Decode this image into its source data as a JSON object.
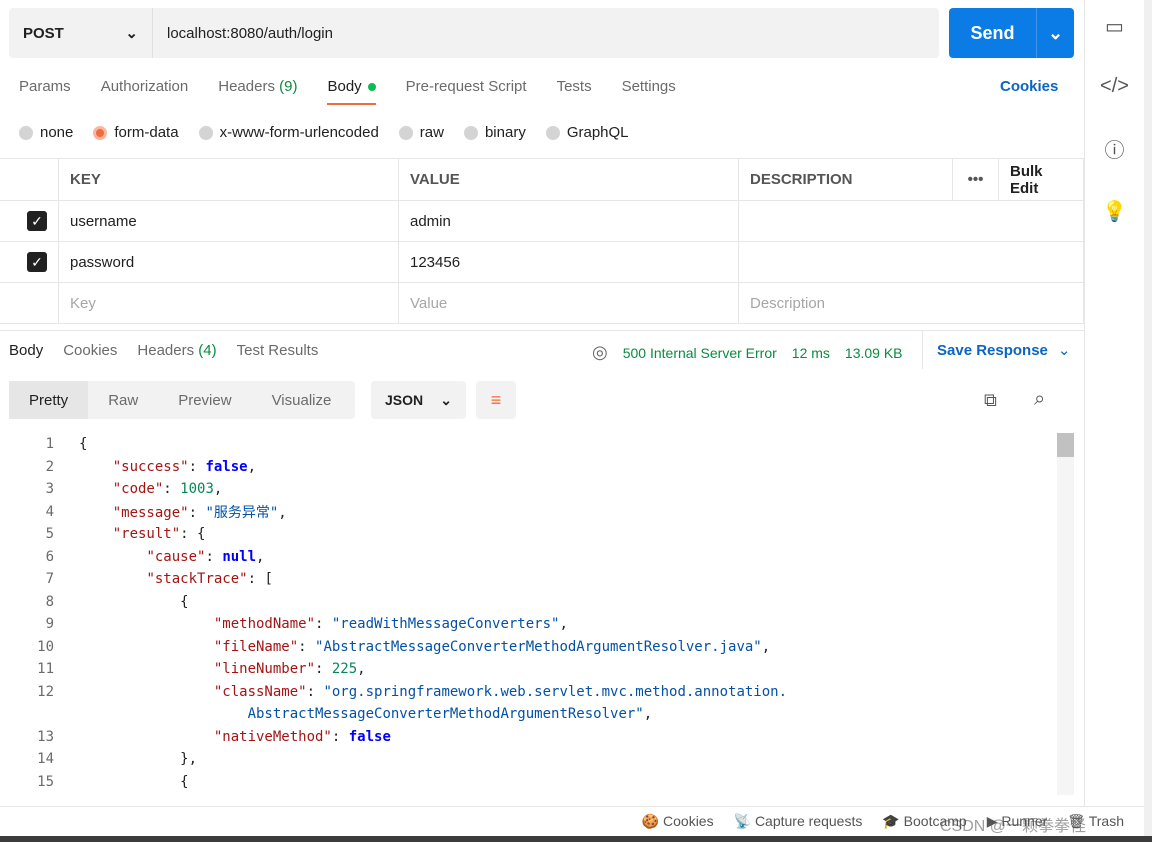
{
  "request": {
    "method": "POST",
    "url": "localhost:8080/auth/login",
    "send": "Send"
  },
  "tabs": [
    {
      "label": "Params"
    },
    {
      "label": "Authorization"
    },
    {
      "label": "Headers",
      "count": "(9)"
    },
    {
      "label": "Body"
    },
    {
      "label": "Pre-request Script"
    },
    {
      "label": "Tests"
    },
    {
      "label": "Settings"
    }
  ],
  "cookies_link": "Cookies",
  "body_types": [
    "none",
    "form-data",
    "x-www-form-urlencoded",
    "raw",
    "binary",
    "GraphQL"
  ],
  "selected_body_type": "form-data",
  "table": {
    "headers": [
      "KEY",
      "VALUE",
      "DESCRIPTION"
    ],
    "more": "•••",
    "bulk_edit": "Bulk Edit",
    "rows": [
      {
        "key": "username",
        "value": "admin",
        "checked": true
      },
      {
        "key": "password",
        "value": "123456",
        "checked": true
      }
    ],
    "placeholders": {
      "key": "Key",
      "value": "Value",
      "description": "Description"
    }
  },
  "response": {
    "tabs": [
      {
        "label": "Body"
      },
      {
        "label": "Cookies"
      },
      {
        "label": "Headers",
        "count": "(4)"
      },
      {
        "label": "Test Results"
      }
    ],
    "status": "500 Internal Server Error",
    "time": "12 ms",
    "size": "13.09 KB",
    "save": "Save Response",
    "views": [
      "Pretty",
      "Raw",
      "Preview",
      "Visualize"
    ],
    "format": "JSON"
  },
  "code_lines": [
    "{",
    "    \"success\": false,",
    "    \"code\": 1003,",
    "    \"message\": \"服务异常\",",
    "    \"result\": {",
    "        \"cause\": null,",
    "        \"stackTrace\": [",
    "            {",
    "                \"methodName\": \"readWithMessageConverters\",",
    "                \"fileName\": \"AbstractMessageConverterMethodArgumentResolver.java\",",
    "                \"lineNumber\": 225,",
    "                \"className\": \"org.springframework.web.servlet.mvc.method.annotation.",
    "                    AbstractMessageConverterMethodArgumentResolver\",",
    "                \"nativeMethod\": false",
    "            },",
    "            {"
  ],
  "line_numbers": [
    "1",
    "2",
    "3",
    "4",
    "5",
    "6",
    "7",
    "8",
    "9",
    "10",
    "11",
    "12",
    "",
    "13",
    "14",
    "15"
  ],
  "footer": [
    "Cookies",
    "Capture requests",
    "Bootcamp",
    "Runner",
    "Trash"
  ],
  "watermark": "CSDN @一颗拳拳怪",
  "colors": {
    "accent": "#f26b3a",
    "primary": "#0b7ce6",
    "status": "#0a8b3f"
  }
}
